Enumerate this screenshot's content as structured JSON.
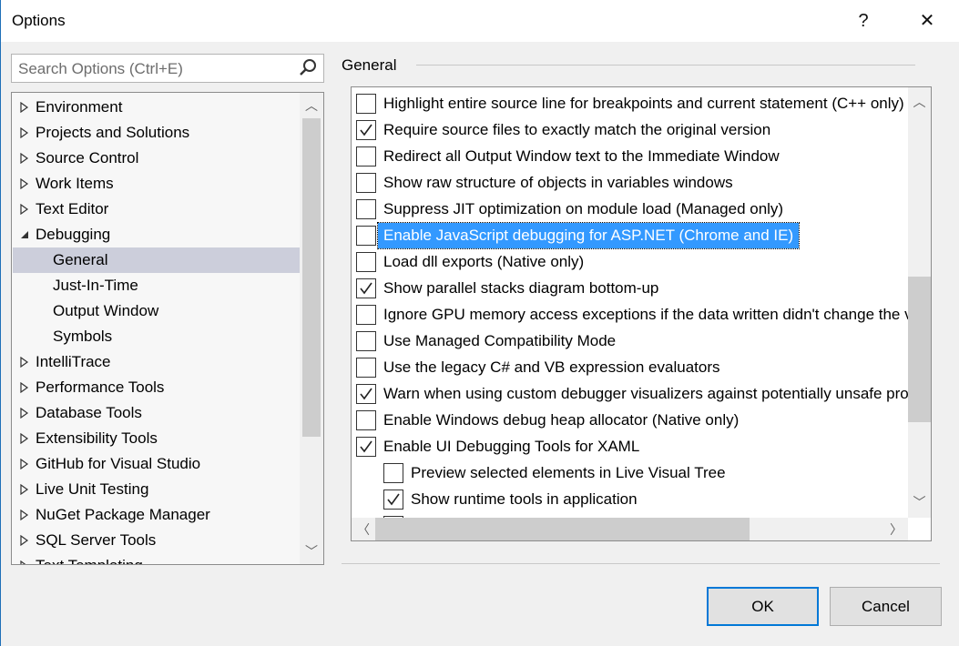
{
  "window": {
    "title": "Options",
    "help_label": "?",
    "close_label": "✕"
  },
  "search": {
    "placeholder": "Search Options (Ctrl+E)",
    "icon": "search-icon"
  },
  "tree": [
    {
      "label": "Environment",
      "level": 0,
      "expand": "collapsed"
    },
    {
      "label": "Projects and Solutions",
      "level": 0,
      "expand": "collapsed"
    },
    {
      "label": "Source Control",
      "level": 0,
      "expand": "collapsed"
    },
    {
      "label": "Work Items",
      "level": 0,
      "expand": "collapsed"
    },
    {
      "label": "Text Editor",
      "level": 0,
      "expand": "collapsed"
    },
    {
      "label": "Debugging",
      "level": 0,
      "expand": "expanded"
    },
    {
      "label": "General",
      "level": 1,
      "selected": true
    },
    {
      "label": "Just-In-Time",
      "level": 1
    },
    {
      "label": "Output Window",
      "level": 1
    },
    {
      "label": "Symbols",
      "level": 1
    },
    {
      "label": "IntelliTrace",
      "level": 0,
      "expand": "collapsed"
    },
    {
      "label": "Performance Tools",
      "level": 0,
      "expand": "collapsed"
    },
    {
      "label": "Database Tools",
      "level": 0,
      "expand": "collapsed"
    },
    {
      "label": "Extensibility Tools",
      "level": 0,
      "expand": "collapsed"
    },
    {
      "label": "GitHub for Visual Studio",
      "level": 0,
      "expand": "collapsed"
    },
    {
      "label": "Live Unit Testing",
      "level": 0,
      "expand": "collapsed"
    },
    {
      "label": "NuGet Package Manager",
      "level": 0,
      "expand": "collapsed"
    },
    {
      "label": "SQL Server Tools",
      "level": 0,
      "expand": "collapsed"
    },
    {
      "label": "Text Templating",
      "level": 0,
      "expand": "collapsed"
    }
  ],
  "section_title": "General",
  "options": [
    {
      "label": "Highlight entire source line for breakpoints and current statement (C++ only)",
      "checked": false,
      "indent": 0
    },
    {
      "label": "Require source files to exactly match the original version",
      "checked": true,
      "indent": 0
    },
    {
      "label": "Redirect all Output Window text to the Immediate Window",
      "checked": false,
      "indent": 0
    },
    {
      "label": "Show raw structure of objects in variables windows",
      "checked": false,
      "indent": 0
    },
    {
      "label": "Suppress JIT optimization on module load (Managed only)",
      "checked": false,
      "indent": 0
    },
    {
      "label": "Enable JavaScript debugging for ASP.NET (Chrome and IE)",
      "checked": false,
      "indent": 0,
      "selected": true
    },
    {
      "label": "Load dll exports (Native only)",
      "checked": false,
      "indent": 0
    },
    {
      "label": "Show parallel stacks diagram bottom-up",
      "checked": true,
      "indent": 0
    },
    {
      "label": "Ignore GPU memory access exceptions if the data written didn't change the value",
      "checked": false,
      "indent": 0
    },
    {
      "label": "Use Managed Compatibility Mode",
      "checked": false,
      "indent": 0
    },
    {
      "label": "Use the legacy C# and VB expression evaluators",
      "checked": false,
      "indent": 0
    },
    {
      "label": "Warn when using custom debugger visualizers against potentially unsafe processes",
      "checked": true,
      "indent": 0
    },
    {
      "label": "Enable Windows debug heap allocator (Native only)",
      "checked": false,
      "indent": 0
    },
    {
      "label": "Enable UI Debugging Tools for XAML",
      "checked": true,
      "indent": 0
    },
    {
      "label": "Preview selected elements in Live Visual Tree",
      "checked": false,
      "indent": 1
    },
    {
      "label": "Show runtime tools in application",
      "checked": true,
      "indent": 1
    },
    {
      "label": "",
      "checked": false,
      "indent": 1
    }
  ],
  "buttons": {
    "ok": "OK",
    "cancel": "Cancel"
  },
  "colors": {
    "selection": "#3399ff",
    "tree_selection": "#cccedb",
    "default_button_border": "#0078d7"
  }
}
